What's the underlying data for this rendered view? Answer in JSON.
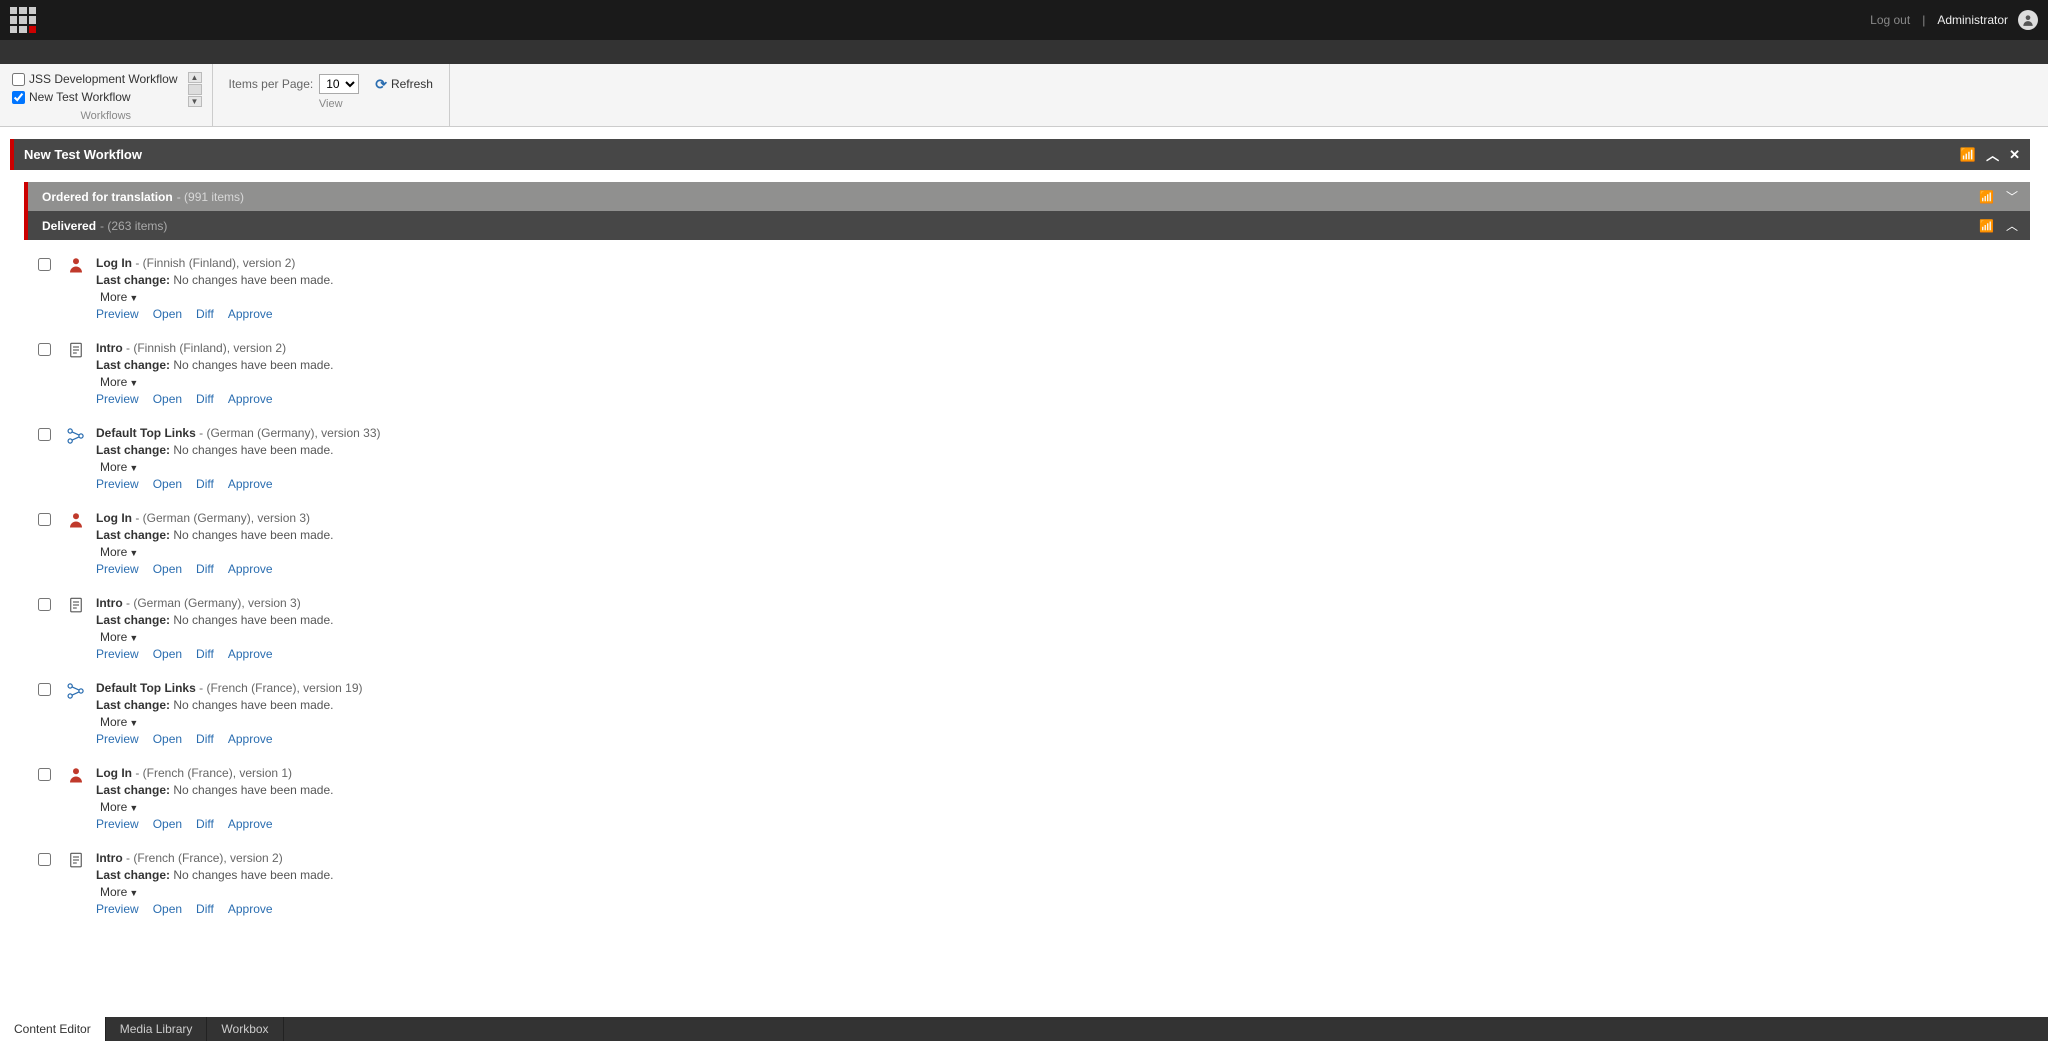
{
  "topbar": {
    "logout_label": "Log out",
    "user_label": "Administrator"
  },
  "ribbon": {
    "workflows": {
      "group_label": "Workflows",
      "items": [
        {
          "label": "JSS Development Workflow",
          "checked": false
        },
        {
          "label": "New Test Workflow",
          "checked": true
        }
      ]
    },
    "view": {
      "group_label": "View",
      "items_per_page_label": "Items per Page:",
      "items_per_page_value": "10",
      "refresh_label": "Refresh"
    }
  },
  "panel": {
    "title": "New Test Workflow",
    "states": [
      {
        "key": "ordered",
        "label": "Ordered for translation",
        "count_suffix": "- (991 items)",
        "collapsed": true
      },
      {
        "key": "delivered",
        "label": "Delivered",
        "count_suffix": "- (263 items)",
        "collapsed": false
      }
    ],
    "delivered_items": [
      {
        "icon": "user",
        "title": "Log In",
        "meta": "- (Finnish (Finland), version 2)",
        "last_label": "Last change:",
        "last_value": "No changes have been made.",
        "more_label": "More"
      },
      {
        "icon": "doc",
        "title": "Intro",
        "meta": "- (Finnish (Finland), version 2)",
        "last_label": "Last change:",
        "last_value": "No changes have been made.",
        "more_label": "More"
      },
      {
        "icon": "links",
        "title": "Default Top Links",
        "meta": "- (German (Germany), version 33)",
        "last_label": "Last change:",
        "last_value": "No changes have been made.",
        "more_label": "More"
      },
      {
        "icon": "user",
        "title": "Log In",
        "meta": "- (German (Germany), version 3)",
        "last_label": "Last change:",
        "last_value": "No changes have been made.",
        "more_label": "More"
      },
      {
        "icon": "doc",
        "title": "Intro",
        "meta": "- (German (Germany), version 3)",
        "last_label": "Last change:",
        "last_value": "No changes have been made.",
        "more_label": "More"
      },
      {
        "icon": "links",
        "title": "Default Top Links",
        "meta": "- (French (France), version 19)",
        "last_label": "Last change:",
        "last_value": "No changes have been made.",
        "more_label": "More"
      },
      {
        "icon": "user",
        "title": "Log In",
        "meta": "- (French (France), version 1)",
        "last_label": "Last change:",
        "last_value": "No changes have been made.",
        "more_label": "More"
      },
      {
        "icon": "doc",
        "title": "Intro",
        "meta": "- (French (France), version 2)",
        "last_label": "Last change:",
        "last_value": "No changes have been made.",
        "more_label": "More"
      }
    ],
    "item_links": {
      "preview": "Preview",
      "open": "Open",
      "diff": "Diff",
      "approve": "Approve"
    }
  },
  "footer": {
    "tabs": [
      {
        "label": "Content Editor",
        "active": true
      },
      {
        "label": "Media Library",
        "active": false
      },
      {
        "label": "Workbox",
        "active": false
      }
    ]
  }
}
